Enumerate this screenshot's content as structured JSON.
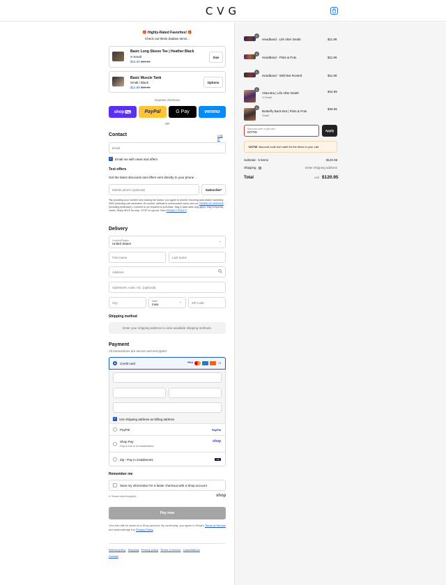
{
  "header": {
    "logo": "CVG"
  },
  "upsell": {
    "title": "🎁 Highly-Rated Favorites! 🎁",
    "subtitle": "Check out these badass items...",
    "items": [
      {
        "name": "Basic Long Sleeve Tee | Heather Black",
        "variant": "X-Small",
        "price": "$15.00",
        "compare": "$24.99",
        "action": "Size"
      },
      {
        "name": "Basic Muscle Tank",
        "variant": "Small / Black",
        "price": "$14.99",
        "compare": "$29.99",
        "action": "Options"
      }
    ]
  },
  "express": {
    "label": "Express checkout",
    "shop": "shop",
    "pay": "Pay",
    "paypal": "PayPal",
    "gpay": "G Pay",
    "venmo": "venmo",
    "or": "OR"
  },
  "contact": {
    "title": "Contact",
    "login": "Log in",
    "email_placeholder": "Email",
    "news_label": "Email me with news and offers"
  },
  "text_offers": {
    "title": "Text offers",
    "subtitle": "Get the latest discounts and offers sent directly to your phone",
    "phone_placeholder": "Mobile phone (optional)",
    "subscribe": "Subscribe*",
    "disclaimer_a": "*By providing your number and clicking the button, you agree to receive recurring auto-dialed marketing SMS (including cart reminders, AI content, artificial or prerecorded voice) and our",
    "terms": "TERMS OF SERVICE",
    "disclaimer_b": "(including arbitration). Consent is not required to purchase. Msg & data rates may apply. Msg frequency varies. Reply HELP for help, STOP to opt-out. View",
    "privacy": "PRIVACY POLICY",
    "end": "."
  },
  "delivery": {
    "title": "Delivery",
    "country_label": "Country/Region",
    "country_value": "United States",
    "first_name": "First name",
    "last_name": "Last name",
    "address": "Address",
    "apartment": "Apartment, suite, etc. (optional)",
    "city": "City",
    "state_label": "State",
    "state_value": "Iowa",
    "zip": "ZIP code"
  },
  "shipping": {
    "title": "Shipping method",
    "placeholder": "Enter your shipping address to view available shipping methods."
  },
  "payment": {
    "title": "Payment",
    "subtitle": "All transactions are secure and encrypted.",
    "credit_card": "Credit card",
    "card_more": "+4",
    "card_brands": [
      "VISA",
      "MC",
      "AMEX",
      "DISCOVER"
    ],
    "billing_label": "Use shipping address as billing address",
    "paypal": "PayPal",
    "paypal_logo": "PayPal",
    "shoppay": "Shop Pay",
    "shoppay_sub": "Pay in full or in installments",
    "shoppay_logo": "shop",
    "zip": "Zip - Pay in installments",
    "zip_logo": "zip"
  },
  "remember": {
    "title": "Remember me",
    "label": "Save my information for a faster checkout with a Shop account",
    "secure": "Secure and encrypted",
    "shop": "shop"
  },
  "pay_button": "Pay now",
  "legal": {
    "text_a": "Your info will be saved to a Shop account. By continuing, you agree to Shop's",
    "tos": "Terms of Service",
    "text_b": "and acknowledge the",
    "privacy": "Privacy Policy",
    "end": "."
  },
  "footer": [
    "Refund policy",
    "Shipping",
    "Privacy policy",
    "Terms of service",
    "Cancellations",
    "Contact"
  ],
  "cart": {
    "items": [
      {
        "qty": "1",
        "name": "Headband - Life After Death",
        "variant": "",
        "price": "$11.99"
      },
      {
        "qty": "1",
        "name": "Headband - Plots & Pots",
        "variant": "",
        "price": "$11.99"
      },
      {
        "qty": "1",
        "name": "Headband - Wild But Rooted",
        "variant": "",
        "price": "$11.99"
      },
      {
        "qty": "1",
        "name": "Vista Bra | Life After Death",
        "variant": "X-Small",
        "price": "$44.99"
      },
      {
        "qty": "1",
        "name": "Butterfly Back Bra | Plots & Pots",
        "variant": "Small",
        "price": "$39.99"
      }
    ],
    "discount_label": "Discount code or gift card",
    "discount_value": "DOTW",
    "apply": "Apply",
    "error_code": "DOTW",
    "error_text": "discount code isn't valid for the items in your cart",
    "subtotal_label": "Subtotal · 5 items",
    "subtotal": "$120.95",
    "shipping_label": "Shipping",
    "shipping_value": "Enter shipping address",
    "total_label": "Total",
    "currency": "USD",
    "total": "$120.95"
  },
  "colors": {
    "accent": "#1a56c4",
    "shop": "#5a31f4",
    "paypal": "#ffc439",
    "venmo": "#008cff"
  }
}
